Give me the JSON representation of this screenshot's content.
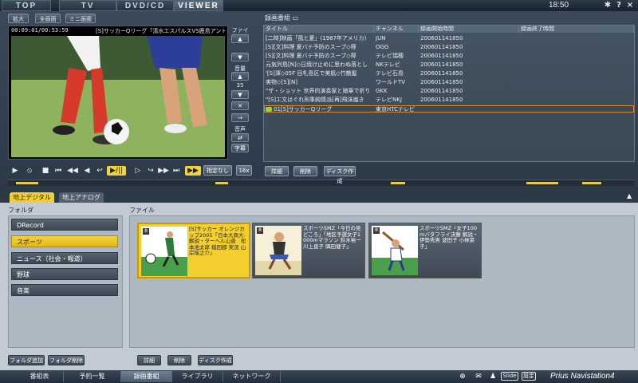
{
  "top_tabs": [
    "TOP",
    "TV",
    "DVD/CD",
    "VIEWER"
  ],
  "active_top_tab": "VIEWER",
  "clock": "18:50",
  "window_buttons": {
    "settings": "✱",
    "help": "?",
    "close": "×"
  },
  "view_buttons": [
    "拡大",
    "全画面",
    "ミニ画面"
  ],
  "player": {
    "timecode": "00:09:01/00:53:59",
    "title": "[S]サッカーQリーグ「清水エスパルスVS鹿島アントラーズ」",
    "file_label": "ファイル",
    "volume_label": "音量",
    "volume_value": "35",
    "audio_label": "音声",
    "sub_label": "字幕",
    "transport": [
      "▶",
      "⦸",
      "■",
      "⏮",
      "◀◀",
      "◀",
      "↩",
      "▶",
      "▶/||",
      "▷",
      "↪",
      "▶▶",
      "⏭"
    ],
    "mode_label": "指定なし",
    "speed_label": "16x"
  },
  "recordings": {
    "header": "録画番組",
    "columns": [
      "タイトル",
      "チャンネル",
      "録画開始時間",
      "録画終了時間"
    ],
    "rows": [
      {
        "title": "[二時]映画「風と夏」(1987年アメリカ)",
        "channel": "JUN",
        "start": "200601141850"
      },
      {
        "title": "[S][文]料理 夏バテ予防のスープ◇得",
        "channel": "OGG",
        "start": "200601141850"
      },
      {
        "title": "[S][文]料理 夏バテ予防のスープ◇得",
        "channel": "テレビ瑞穂",
        "start": "200601141850"
      },
      {
        "title": "元気列島[N]◇日焼け止めに思わぬ落とし",
        "channel": "NKテレビ",
        "start": "200601141850"
      },
      {
        "title": "'[S]渾◇05F 目札島区で美肌◇竹散髪",
        "channel": "テレビ石島",
        "start": "200601141850"
      },
      {
        "title": "実物◇[S][N]",
        "channel": "ワールドTV",
        "start": "200601141850"
      },
      {
        "title": "\"ザ・ショット 世界的演奏家と随筆で折り",
        "channel": "GKK",
        "start": "200601141850"
      },
      {
        "title": "\"[S]エ文はぐれ刑事純情派[再]飛沫嵐き",
        "channel": "テレビNKJ",
        "start": "200601141850"
      },
      {
        "title": "01[S]サッカーQリーグ",
        "channel": "東京HTCテレビ",
        "start": ""
      }
    ],
    "actions": [
      "詳細",
      "削除",
      "ディスク作成"
    ]
  },
  "lower": {
    "tabs": [
      "地上デジタル",
      "地上アナログ"
    ],
    "active_tab": "地上デジタル",
    "folder_header": "フォルダ",
    "file_header": "ファイル",
    "folders": [
      "DRecord",
      "スポーツ",
      "ニュース（社会・報道）",
      "野球",
      "音楽"
    ],
    "active_folder": "スポーツ",
    "files": [
      {
        "badge": "未",
        "text": "[S]サッカー オレンジカップ2005「日本大商大-解説・ターヘル山道　松本池太郎 稲田郡 実況 山岸瑶之介」"
      },
      {
        "badge": "未",
        "text": "スポーツSMZ「今日の見どころ」「地区予選女子1000mマラソン 鈴木裕一 川上直子 隅田健子」"
      },
      {
        "badge": "未",
        "text": "スポーツSMZ「女子100mバタフライ決勝 解説・伊勢秀男 波田子 小林菜子」"
      }
    ],
    "folder_buttons": [
      "フォルダ追加",
      "フォルダ削除"
    ],
    "file_buttons": [
      "詳細",
      "削除",
      "ディスク作成"
    ]
  },
  "bottom_nav": [
    "番組表",
    "予約一覧",
    "録画番組",
    "ライブラリ",
    "ネットワーク"
  ],
  "active_bottom": "録画番組",
  "bottom_icons": {
    "globe": "⊕",
    "mail": "✉",
    "person": "♟",
    "slide": "Slide",
    "settings": "設定"
  },
  "brand": "Prius Navistation4"
}
